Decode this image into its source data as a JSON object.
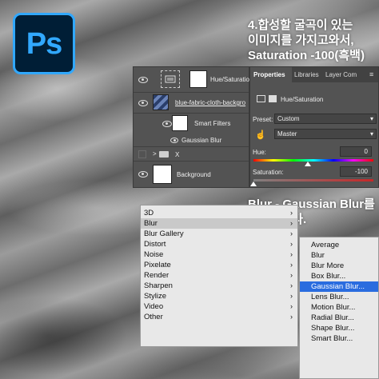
{
  "logo": {
    "text": "Ps",
    "color": "#31a8ff",
    "background": "#001e36"
  },
  "captions": {
    "top": [
      "4.합성할 굴곡이 있는",
      "이미지를 가지고와서,",
      "Saturation -100(흑백)"
    ],
    "bottom": [
      "Blur - Gaussian Blur를",
      "적용합니다."
    ]
  },
  "layers": {
    "rows": [
      {
        "label": "Hue/Saturation",
        "thumb_icon": "adjustment-icon"
      },
      {
        "label": "blue-fabric-cloth-backgro"
      },
      {
        "label": "Smart Filters"
      },
      {
        "label": "Gaussian Blur"
      },
      {
        "label": "X"
      },
      {
        "label": "Background"
      }
    ]
  },
  "properties": {
    "tabs": [
      "Properties",
      "Libraries",
      "Layer Com"
    ],
    "header": "Hue/Saturation",
    "preset_label": "Preset:",
    "preset_value": "Custom",
    "channel_value": "Master",
    "hue_label": "Hue:",
    "hue_value": "0",
    "saturation_label": "Saturation:",
    "saturation_value": "-100"
  },
  "menu": {
    "items": [
      {
        "label": "3D",
        "arrow": "›"
      },
      {
        "label": "Blur",
        "arrow": "›"
      },
      {
        "label": "Blur Gallery",
        "arrow": "›"
      },
      {
        "label": "Distort",
        "arrow": "›"
      },
      {
        "label": "Noise",
        "arrow": "›"
      },
      {
        "label": "Pixelate",
        "arrow": "›"
      },
      {
        "label": "Render",
        "arrow": "›"
      },
      {
        "label": "Sharpen",
        "arrow": "›"
      },
      {
        "label": "Stylize",
        "arrow": "›"
      },
      {
        "label": "Video",
        "arrow": "›"
      },
      {
        "label": "Other",
        "arrow": "›"
      }
    ],
    "highlighted": "Blur"
  },
  "submenu": {
    "items": [
      "Average",
      "Blur",
      "Blur More",
      "Box Blur...",
      "Gaussian Blur...",
      "Lens Blur...",
      "Motion Blur...",
      "Radial Blur...",
      "Shape Blur...",
      "Smart Blur..."
    ],
    "selected": "Gaussian Blur..."
  }
}
